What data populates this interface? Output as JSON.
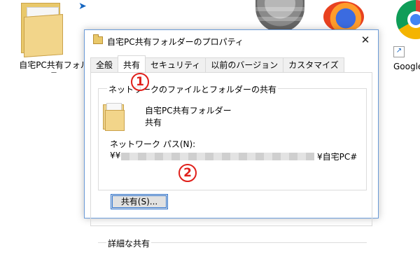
{
  "desktop": {
    "left_icon_label": "自宅PC共有フォル",
    "left_icon_sublabel": "ー",
    "right_icon_label": "Google"
  },
  "dialog": {
    "title": "自宅PC共有フォルダーのプロパティ",
    "close_glyph": "✕",
    "tabs": [
      {
        "label": "全般",
        "active": false
      },
      {
        "label": "共有",
        "active": true
      },
      {
        "label": "セキュリティ",
        "active": false
      },
      {
        "label": "以前のバージョン",
        "active": false
      },
      {
        "label": "カスタマイズ",
        "active": false
      }
    ],
    "network_group_label": "ネットワークのファイルとフォルダーの共有",
    "folder_name": "自宅PC共有フォルダー",
    "share_status": "共有",
    "network_path_label": "ネットワーク パス(N):",
    "network_path_prefix": "¥¥",
    "network_path_suffix": "¥自宅PC#",
    "share_button_label": "共有(S)...",
    "advanced_group_label": "詳細な共有"
  },
  "annotations": {
    "marker_1": "1",
    "marker_2": "2",
    "color": "#e0201b"
  },
  "icons": [
    "folder-icon",
    "pin-icon",
    "google-earth-icon",
    "firefox-icon",
    "chrome-icon",
    "shortcut-arrow-icon",
    "close-icon",
    "folder-title-icon",
    "shared-folder-icon"
  ]
}
